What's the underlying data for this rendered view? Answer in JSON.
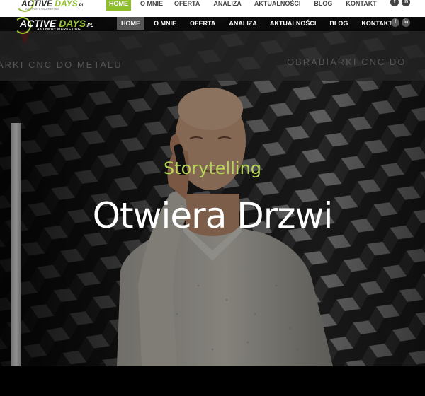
{
  "brand": {
    "name_main": "ACTIVE",
    "name_accent": "DAYS",
    "name_suffix": ".PL",
    "tagline": "AKTYWNY MARKETING",
    "tagline_small": "AKTYWNY MARKETING",
    "accent_color": "#8fbf2a"
  },
  "top_nav": {
    "items": [
      {
        "label": "HOME",
        "active": true
      },
      {
        "label": "O MNIE"
      },
      {
        "label": "OFERTA"
      },
      {
        "label": "ANALIZA"
      },
      {
        "label": "AKTUALNOŚCI"
      },
      {
        "label": "BLOG"
      },
      {
        "label": "KONTAKT"
      }
    ]
  },
  "nav": {
    "items": [
      {
        "label": "HOME",
        "active": true
      },
      {
        "label": "O MNIE"
      },
      {
        "label": "OFERTA"
      },
      {
        "label": "ANALIZA"
      },
      {
        "label": "AKTUALNOŚCI"
      },
      {
        "label": "BLOG"
      },
      {
        "label": "KONTAKT"
      }
    ]
  },
  "social": {
    "facebook": "f",
    "linkedin": "in"
  },
  "hero": {
    "wall_text_left": "ARKI CNC DO METALU",
    "wall_text_right": "OBRABIARKI CNC DO",
    "subtitle": "Storytelling",
    "title": "Otwiera Drzwi"
  }
}
